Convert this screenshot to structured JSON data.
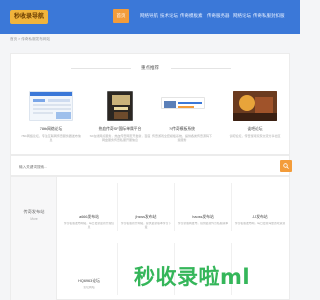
{
  "header": {
    "logo_text": "秒收录导航",
    "nav": [
      "首页",
      "网络导航",
      "技术论坛",
      "传奇模板素",
      "传奇服务器",
      "网络论坛",
      "传奇私服封扣服"
    ],
    "active_index": 0
  },
  "breadcrumb": "首页 > 传奇私服发布网站",
  "recommend": {
    "title": "重点推荐",
    "items": [
      {
        "name": "78tb网络论坛",
        "desc": "78tb网络论坛，专注互联网传奇服务器发布信息"
      },
      {
        "name": "热血传奇SF国际单属平台",
        "desc": "SF在线网点服务，热血传奇网页开发新，百度网盘服务传奇私服开服信息"
      },
      {
        "name": "?/传奇模板系统",
        "desc": "传奇游戏全套模板系统，提供各类传奇源码下载服务"
      },
      {
        "name": "谈吧论坛",
        "desc": "谈吧论坛，传奇游戏玩家交流分享社区"
      }
    ]
  },
  "search": {
    "placeholder": "输入关键词搜索..."
  },
  "list": {
    "section_title": "传奇发布站",
    "section_more": "More",
    "sites": [
      {
        "name": "a666发布站",
        "desc": "传奇私服发布网站，每日更新最新开服信息"
      },
      {
        "name": "jhsws发布站",
        "desc": "传奇私服新开网站，提供最新版本传奇下载"
      },
      {
        "name": "haoss发布站",
        "desc": "传奇新服网发布，提供最新传奇私服版本"
      },
      {
        "name": "JJ发布站",
        "desc": "传奇私服发布网，每日更新海量游戏资源"
      },
      {
        "name": "HQ6963论坛",
        "desc": "论坛网站"
      },
      {
        "name": "",
        "desc": ""
      },
      {
        "name": "",
        "desc": ""
      },
      {
        "name": "",
        "desc": ""
      }
    ]
  },
  "watermark": "秒收录啦ml",
  "colors": {
    "header": "#3b78d8",
    "accent": "#f39c3a",
    "watermark": "#35b65a"
  }
}
